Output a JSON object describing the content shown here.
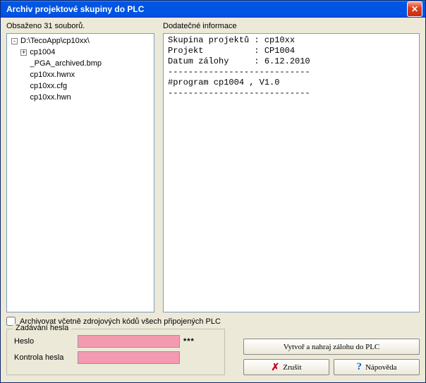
{
  "window": {
    "title": "Archiv projektové skupiny do PLC"
  },
  "left": {
    "header": "Obsaženo 31 souborů.",
    "root": "D:\\TecoApp\\cp10xx\\",
    "children": [
      {
        "label": "cp1004",
        "expandable": true
      },
      {
        "label": "_PGA_archived.bmp",
        "expandable": false
      },
      {
        "label": "cp10xx.hwnx",
        "expandable": false
      },
      {
        "label": "cp10xx.cfg",
        "expandable": false
      },
      {
        "label": "cp10xx.hwn",
        "expandable": false
      }
    ]
  },
  "right": {
    "header": "Dodatečné informace",
    "lines": [
      "Skupina projektů : cp10xx",
      "Projekt          : CP1004",
      "Datum zálohy     : 6.12.2010",
      "----------------------------",
      "#program cp1004 , V1.0",
      "----------------------------"
    ]
  },
  "checkbox": {
    "label": "Archivovat včetně zdrojových kódů všech připojených PLC"
  },
  "password": {
    "group_title": "Zadávání hesla",
    "label1": "Heslo",
    "label2": "Kontrola hesla",
    "stars": "***"
  },
  "buttons": {
    "create": "Vytvoř a nahraj zálohu do PLC",
    "cancel": "Zrušit",
    "help": "Nápověda"
  }
}
